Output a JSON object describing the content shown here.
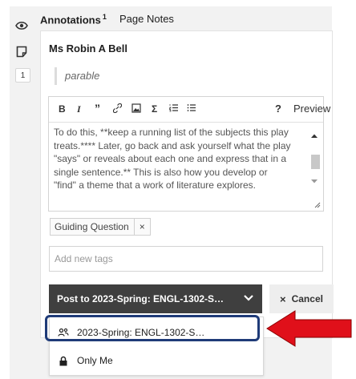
{
  "tabs": {
    "annotations_label": "Annotations",
    "annotations_count": "1",
    "page_notes_label": "Page Notes"
  },
  "rail": {
    "icons": [
      "eye-icon",
      "page-note-icon"
    ],
    "annotation_count": "1"
  },
  "annotation": {
    "author": "Ms Robin A Bell",
    "quote": "parable",
    "body": "To do this, **keep a running list of the subjects this play treats.**** Later, go back and ask yourself what the play \"says\" or reveals about each one and express that in a single sentence.** This is also how you develop or \"find\" a theme that a work of literature explores."
  },
  "toolbar": {
    "bold": "B",
    "italic": "I",
    "quote": "”",
    "link": "🔗",
    "image": "▣",
    "math": "Σ",
    "numbered_list": "☰",
    "bulleted_list": "☰",
    "help": "?",
    "preview": "Preview"
  },
  "tags": {
    "items": [
      "Guiding Question"
    ],
    "remove_symbol": "×",
    "placeholder": "Add new tags"
  },
  "post": {
    "label": "Post to 2023-Spring: ENGL-1302-S…",
    "cancel_label": "Cancel",
    "cancel_symbol": "×"
  },
  "dropdown": {
    "options": [
      {
        "label": "2023-Spring: ENGL-1302-S…",
        "icon": "group-icon"
      },
      {
        "label": "Only Me",
        "icon": "lock-icon"
      }
    ]
  },
  "colors": {
    "post_button": "#3f3f3f",
    "highlight_border": "#1f3b78",
    "arrow_fill": "#e0101a"
  }
}
